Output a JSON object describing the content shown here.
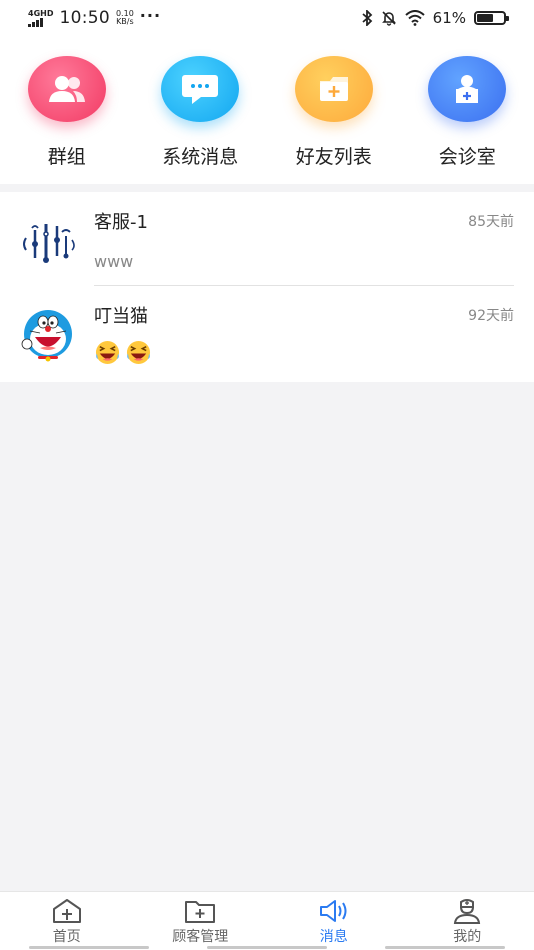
{
  "status_bar": {
    "network": "4GHD",
    "time": "10:50",
    "speed_value": "0.10",
    "speed_unit": "KB/s",
    "more": "···",
    "battery_percent": "61%",
    "battery_level": 0.61
  },
  "quick_actions": [
    {
      "label": "群组",
      "icon": "group-icon",
      "color": "#f23a63"
    },
    {
      "label": "系统消息",
      "icon": "system-message-icon",
      "color": "#12a6f0"
    },
    {
      "label": "好友列表",
      "icon": "friend-list-icon",
      "color": "#fda93b"
    },
    {
      "label": "会诊室",
      "icon": "consultation-room-icon",
      "color": "#3b6ff0"
    }
  ],
  "conversations": [
    {
      "name": "客服-1",
      "time": "85天前",
      "message": "www",
      "avatar": "customer-service-logo"
    },
    {
      "name": "叮当猫",
      "time": "92天前",
      "message": "",
      "avatar": "doraemon-avatar",
      "emojis": [
        "laughing-crying-emoji",
        "laughing-crying-emoji"
      ]
    }
  ],
  "bottom_nav": [
    {
      "label": "首页",
      "icon": "home-icon",
      "active": false
    },
    {
      "label": "顾客管理",
      "icon": "folder-plus-icon",
      "active": false
    },
    {
      "label": "消息",
      "icon": "speaker-icon",
      "active": true
    },
    {
      "label": "我的",
      "icon": "doctor-icon",
      "active": false
    }
  ],
  "colors": {
    "accent": "#2b7bf1",
    "background": "#f3f3f5"
  }
}
